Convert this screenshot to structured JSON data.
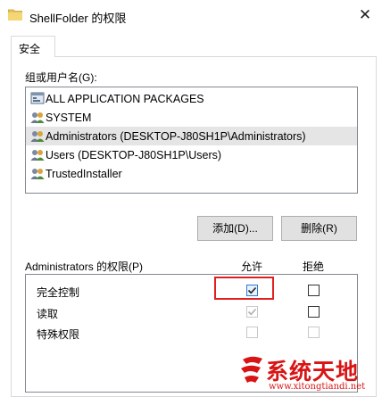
{
  "window": {
    "title": "ShellFolder 的权限",
    "close_glyph": "✕"
  },
  "tabs": [
    {
      "label": "安全",
      "selected": true
    }
  ],
  "users_group": {
    "label": "组或用户名(G):",
    "items": [
      {
        "label": "ALL APPLICATION PACKAGES",
        "icon": "app-packages-icon",
        "selected": false
      },
      {
        "label": "SYSTEM",
        "icon": "users-group-icon",
        "selected": false
      },
      {
        "label": "Administrators (DESKTOP-J80SH1P\\Administrators)",
        "icon": "users-group-icon",
        "selected": true
      },
      {
        "label": "Users (DESKTOP-J80SH1P\\Users)",
        "icon": "users-group-icon",
        "selected": false
      },
      {
        "label": "TrustedInstaller",
        "icon": "users-group-icon",
        "selected": false
      }
    ]
  },
  "buttons": {
    "add_label": "添加(D)...",
    "remove_label": "删除(R)"
  },
  "permissions": {
    "header": "Administrators 的权限(P)",
    "allow_header": "允许",
    "deny_header": "拒绝",
    "rows": [
      {
        "label": "完全控制",
        "allow": true,
        "allow_enabled": true,
        "deny": false,
        "deny_enabled": true
      },
      {
        "label": "读取",
        "allow": true,
        "allow_enabled": false,
        "deny": false,
        "deny_enabled": true
      },
      {
        "label": "特殊权限",
        "allow": false,
        "allow_enabled": false,
        "deny": false,
        "deny_enabled": false
      }
    ]
  },
  "watermark": {
    "brand": "系统天地",
    "url": "www.xitongtiandi.net"
  },
  "colors": {
    "highlight": "#e02020",
    "watermark": "#d81414",
    "selection": "#e5e5e5"
  }
}
